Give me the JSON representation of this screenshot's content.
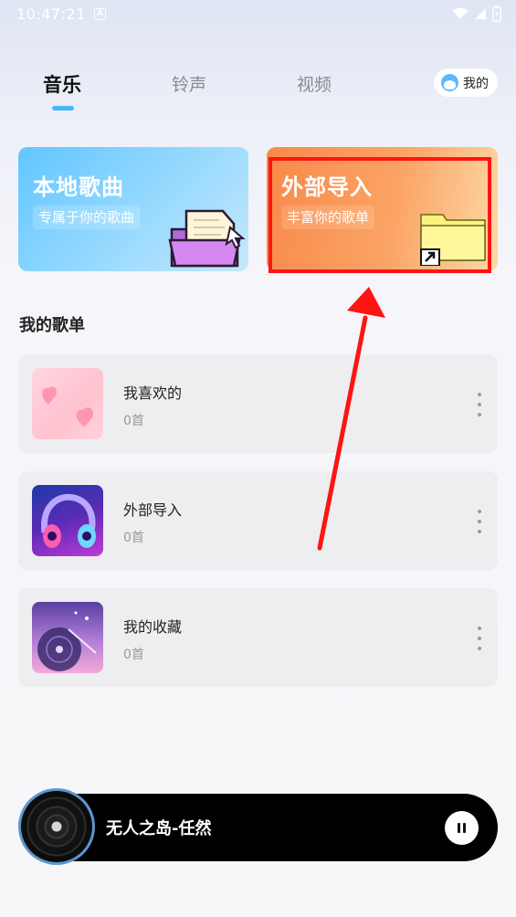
{
  "status_bar": {
    "time": "10:47:21",
    "notif_badge": "A"
  },
  "tabs": [
    {
      "label": "音乐",
      "active": true
    },
    {
      "label": "铃声",
      "active": false
    },
    {
      "label": "视频",
      "active": false
    }
  ],
  "profile": {
    "label": "我的"
  },
  "cards": {
    "local": {
      "title": "本地歌曲",
      "subtitle": "专属于你的歌曲"
    },
    "import": {
      "title": "外部导入",
      "subtitle": "丰富你的歌单"
    }
  },
  "section": {
    "title": "我的歌单"
  },
  "playlists": [
    {
      "name": "我喜欢的",
      "count": "0首"
    },
    {
      "name": "外部导入",
      "count": "0首"
    },
    {
      "name": "我的收藏",
      "count": "0首"
    }
  ],
  "player": {
    "title": "无人之岛-任然"
  },
  "colors": {
    "accent": "#49b5ff",
    "highlight": "#ff1414",
    "local_card": "#62c6ff",
    "import_card": "#f8894a"
  }
}
